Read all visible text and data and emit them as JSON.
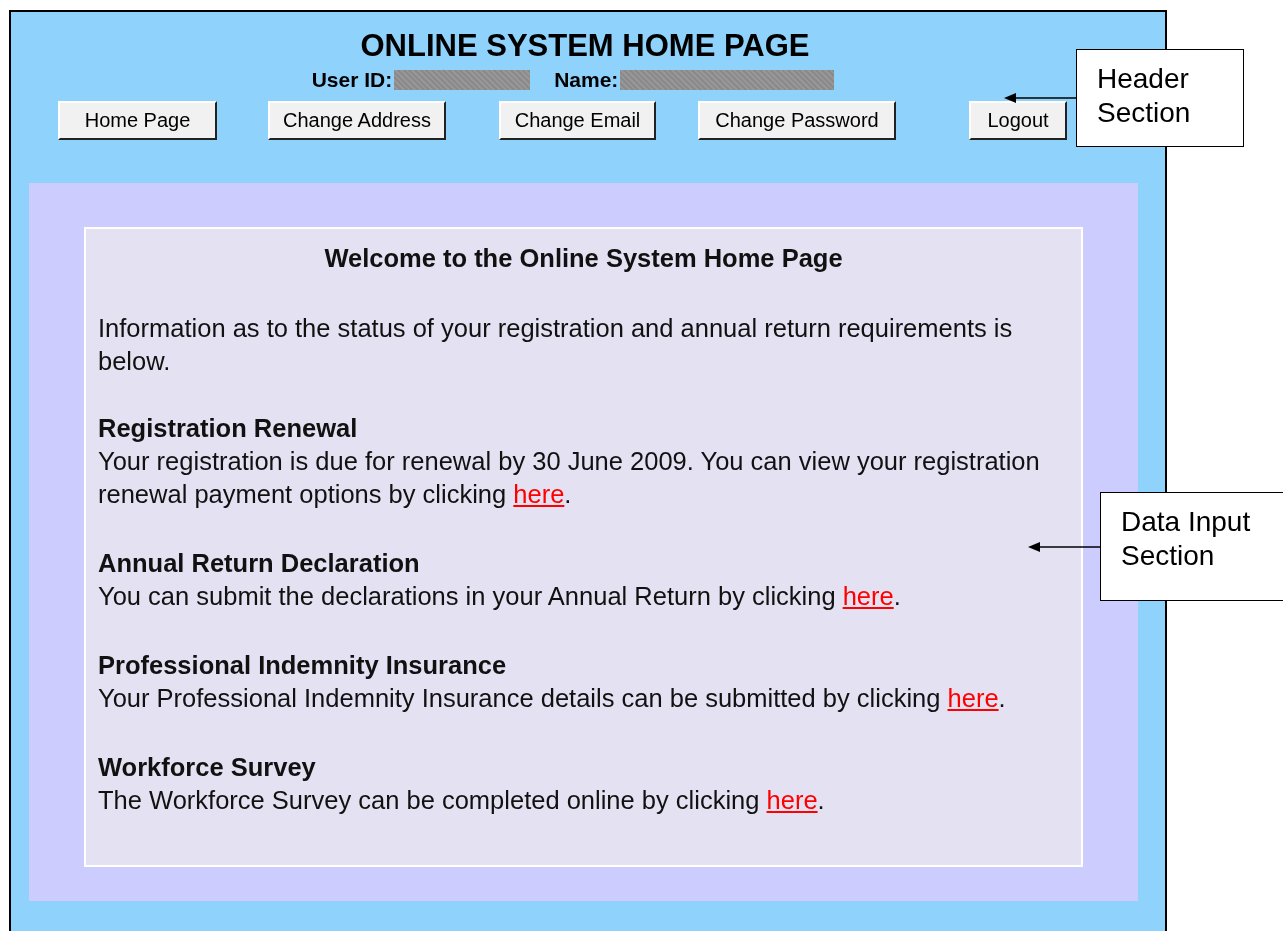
{
  "header": {
    "title": "ONLINE SYSTEM HOME PAGE",
    "user_fields": [
      {
        "label": "User ID:",
        "redacted": true
      },
      {
        "label": "Name:",
        "redacted": true
      }
    ],
    "buttons": [
      "Home Page",
      "Change Address",
      "Change Email",
      "Change Password",
      "Logout"
    ]
  },
  "content": {
    "heading": "Welcome to the Online System Home Page",
    "intro": "Information as to the status of your registration and annual return requirements is below.",
    "sections": [
      {
        "heading": "Registration Renewal",
        "text": "Your registration is due for renewal by 30 June 2009. You can view your registration renewal payment options by clicking ",
        "link": "here",
        "after": "."
      },
      {
        "heading": "Annual Return Declaration",
        "text": "You can submit the declarations in your Annual Return by clicking ",
        "link": "here",
        "after": "."
      },
      {
        "heading": "Professional Indemnity Insurance",
        "text": "Your Professional Indemnity Insurance details can be submitted by clicking ",
        "link": "here",
        "after": "."
      },
      {
        "heading": "Workforce Survey",
        "text": "The Workforce Survey can be completed online by clicking ",
        "link": "here",
        "after": "."
      }
    ]
  },
  "callouts": [
    {
      "kind": "header",
      "text": "Header Section"
    },
    {
      "kind": "data",
      "text": "Data Input Section"
    }
  ]
}
